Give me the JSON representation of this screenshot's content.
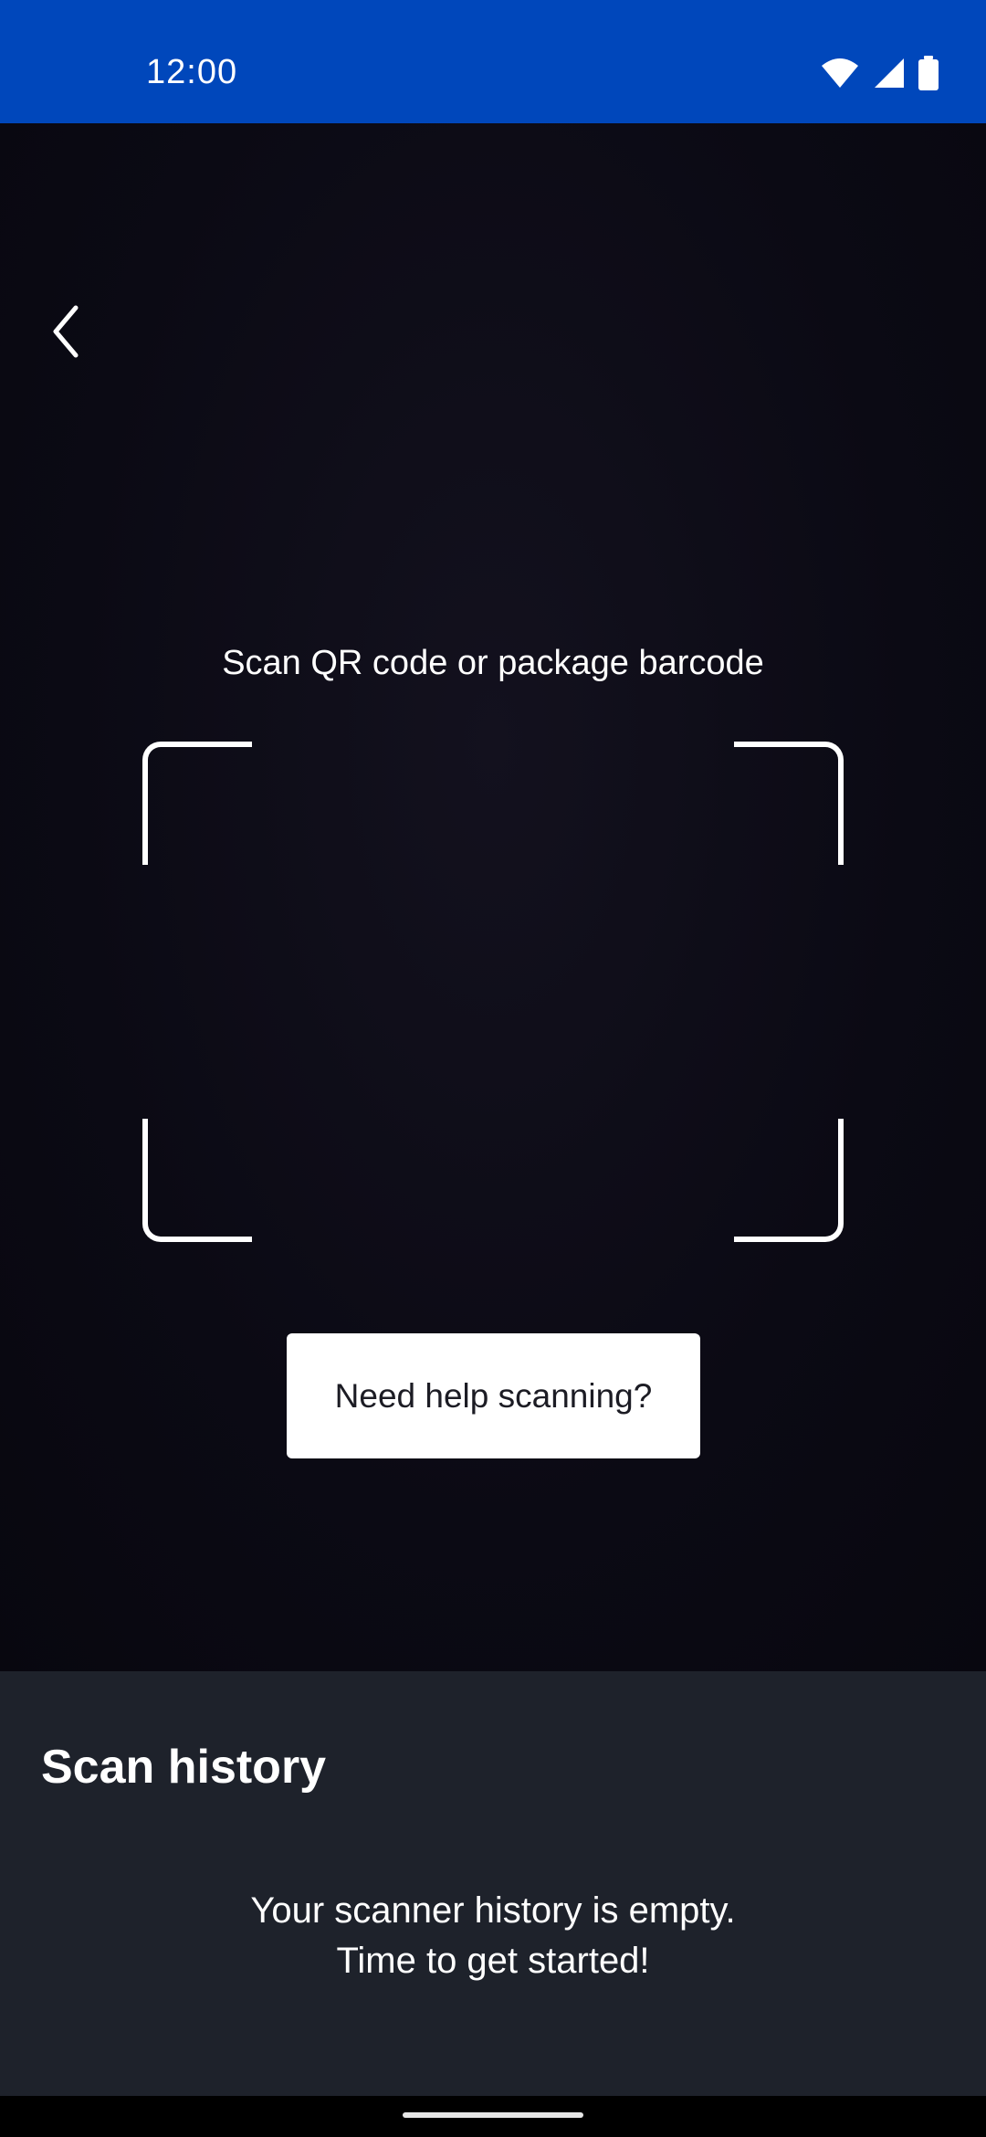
{
  "status_bar": {
    "time": "12:00",
    "background": "#0047bb",
    "icons": [
      "wifi-icon",
      "signal-icon",
      "battery-icon"
    ]
  },
  "scanner": {
    "back_icon": "chevron-left-icon",
    "instruction": "Scan QR code or package barcode",
    "help_button_label": "Need help scanning?"
  },
  "history": {
    "title": "Scan history",
    "empty_line_1": "Your scanner history is empty.",
    "empty_line_2": "Time to get started!"
  },
  "colors": {
    "brand_blue": "#0047bb",
    "camera_background": "#0b0a14",
    "sheet_background": "#1e222b",
    "text_light": "#ffffff"
  }
}
